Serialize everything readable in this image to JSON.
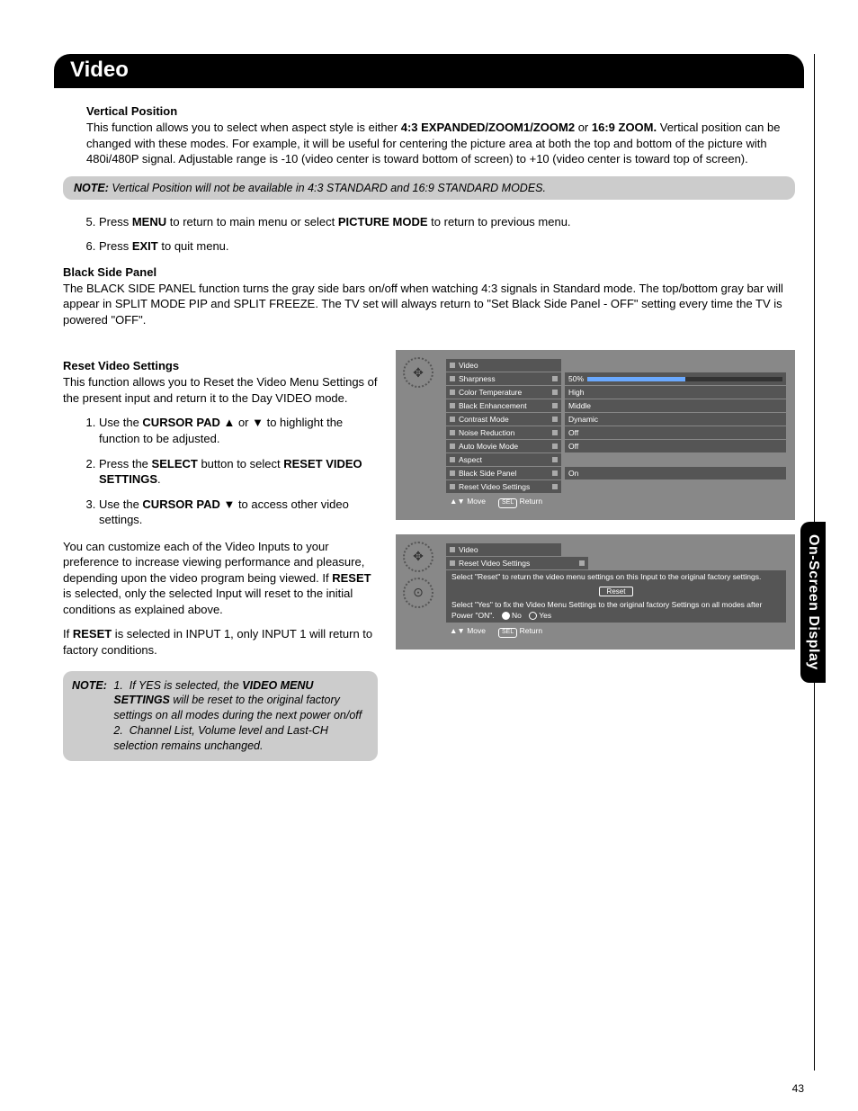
{
  "page_number": "43",
  "section_title": "Video",
  "side_tab": "On-Screen Display",
  "vertical_position": {
    "heading": "Vertical Position",
    "para": "This function allows you to select when aspect style is either ",
    "bold1": "4:3 EXPANDED/ZOOM1/ZOOM2",
    "mid": " or ",
    "bold2": "16:9 ZOOM.",
    "rest": " Vertical position can be changed with these modes. For example, it will be useful for centering the picture area at both the top and bottom of the picture with 480i/480P signal. Adjustable range is -10 (video center is toward bottom of screen) to +10 (video center is toward top of screen)."
  },
  "note1": {
    "lead": "NOTE:",
    "text": "  Vertical Position will not be available in 4:3 STANDARD and 16:9 STANDARD MODES."
  },
  "steps_a": {
    "s5a": "Press ",
    "s5b": "MENU",
    "s5c": " to return to main menu or select ",
    "s5d": "PICTURE MODE",
    "s5e": " to return to previous menu.",
    "s6a": "Press ",
    "s6b": "EXIT",
    "s6c": " to quit menu."
  },
  "black_side": {
    "heading": "Black Side Panel",
    "text": "The BLACK SIDE PANEL function turns the gray side bars on/off when watching 4:3 signals in Standard mode. The top/bottom gray bar will appear in SPLIT MODE PIP and SPLIT FREEZE. The TV set will always return to \"Set Black Side Panel - OFF\" setting every time the TV is powered \"OFF\"."
  },
  "reset": {
    "heading": "Reset Video Settings",
    "intro": "This function allows you to Reset the Video Menu Settings of the present input and return it to the Day VIDEO mode.",
    "s1a": "Use the ",
    "s1b": "CURSOR PAD",
    "s1c": " ▲ or ▼ to highlight the function to be adjusted.",
    "s2a": "Press the ",
    "s2b": "SELECT",
    "s2c": " button to select ",
    "s2d": "RESET VIDEO SETTINGS",
    "s2e": ".",
    "s3a": "Use the ",
    "s3b": "CURSOR PAD",
    "s3c": " ▼ to access other video settings.",
    "p2a": "You can customize each of the Video Inputs to your preference to increase viewing performance and pleasure, depending upon the video program being viewed. If ",
    "p2b": "RESET",
    "p2c": " is selected, only the selected Input will reset to the initial conditions as explained above.",
    "p3a": "If ",
    "p3b": "RESET",
    "p3c": " is selected in INPUT 1, only INPUT 1 will return to factory conditions."
  },
  "note2": {
    "lead": "NOTE:",
    "n1a": "If YES is selected, the ",
    "n1b": "VIDEO MENU SETTINGS",
    "n1c": " will be reset to the original factory settings on all modes during the next power on/off",
    "n2": "Channel List, Volume level and Last-CH selection remains unchanged."
  },
  "osd1": {
    "title": "Video",
    "rows": [
      {
        "label": "Sharpness",
        "val": "50%",
        "bar": 50
      },
      {
        "label": "Color Temperature",
        "val": "High"
      },
      {
        "label": "Black Enhancement",
        "val": "Middle"
      },
      {
        "label": "Contrast Mode",
        "val": "Dynamic"
      },
      {
        "label": "Noise Reduction",
        "val": "Off"
      },
      {
        "label": "Auto Movie Mode",
        "val": "Off"
      },
      {
        "label": "Aspect",
        "val": ""
      },
      {
        "label": "Black Side Panel",
        "val": "On"
      },
      {
        "label": "Reset Video Settings",
        "val": ""
      }
    ],
    "footer_move": "Move",
    "footer_sel": "SEL",
    "footer_return": "Return"
  },
  "osd2": {
    "title": "Video",
    "sub": "Reset Video Settings",
    "line1": "Select \"Reset\" to return the video menu settings on this Input to the original factory settings.",
    "reset": "Reset",
    "line2": "Select \"Yes\" to fix the Video Menu Settings to the original factory Settings on all modes after Power \"ON\".",
    "no": "No",
    "yes": "Yes",
    "footer_move": "Move",
    "footer_sel": "SEL",
    "footer_return": "Return"
  }
}
